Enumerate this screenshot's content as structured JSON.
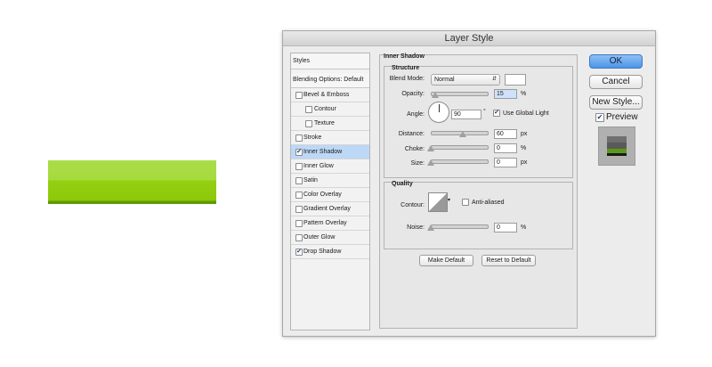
{
  "colors": {
    "accent_blue": "#4c94e8",
    "green_light": "#a5db3e",
    "green_dark": "#8dc80a",
    "selection": "#bdd7f6"
  },
  "dialog": {
    "title": "Layer Style"
  },
  "styles_panel": {
    "header": "Styles",
    "blending": "Blending Options: Default",
    "items": [
      {
        "label": "Bevel & Emboss",
        "checked": false,
        "indent": 0
      },
      {
        "label": "Contour",
        "checked": false,
        "indent": 1
      },
      {
        "label": "Texture",
        "checked": false,
        "indent": 1
      },
      {
        "label": "Stroke",
        "checked": false,
        "indent": 0
      },
      {
        "label": "Inner Shadow",
        "checked": true,
        "indent": 0,
        "selected": true
      },
      {
        "label": "Inner Glow",
        "checked": false,
        "indent": 0
      },
      {
        "label": "Satin",
        "checked": false,
        "indent": 0
      },
      {
        "label": "Color Overlay",
        "checked": false,
        "indent": 0
      },
      {
        "label": "Gradient Overlay",
        "checked": false,
        "indent": 0
      },
      {
        "label": "Pattern Overlay",
        "checked": false,
        "indent": 0
      },
      {
        "label": "Outer Glow",
        "checked": false,
        "indent": 0
      },
      {
        "label": "Drop Shadow",
        "checked": true,
        "indent": 0
      }
    ]
  },
  "inner_shadow": {
    "title": "Inner Shadow",
    "structure": {
      "title": "Structure",
      "blend_mode_label": "Blend Mode:",
      "blend_mode_value": "Normal",
      "opacity_label": "Opacity:",
      "opacity_value": "15",
      "opacity_unit": "%",
      "angle_label": "Angle:",
      "angle_value": "90",
      "angle_unit": "°",
      "global_light_label": "Use Global Light",
      "global_light_checked": true,
      "distance_label": "Distance:",
      "distance_value": "60",
      "distance_unit": "px",
      "choke_label": "Choke:",
      "choke_value": "0",
      "choke_unit": "%",
      "size_label": "Size:",
      "size_value": "0",
      "size_unit": "px"
    },
    "quality": {
      "title": "Quality",
      "contour_label": "Contour:",
      "anti_aliased_label": "Anti-aliased",
      "anti_aliased_checked": false,
      "noise_label": "Noise:",
      "noise_value": "0",
      "noise_unit": "%"
    },
    "make_default": "Make Default",
    "reset_default": "Reset to Default"
  },
  "buttons": {
    "ok": "OK",
    "cancel": "Cancel",
    "new_style": "New Style...",
    "preview": "Preview",
    "preview_checked": true
  }
}
